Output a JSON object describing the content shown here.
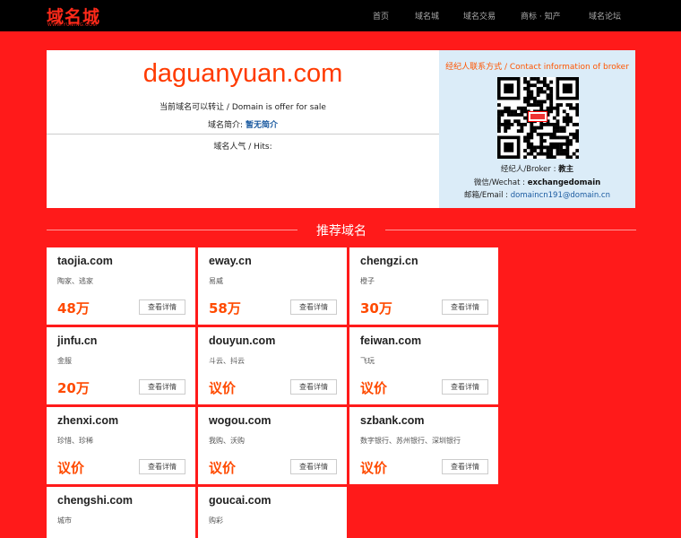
{
  "header": {
    "logo_text": "域名城",
    "logo_sub": "WWW.YUMING.COM",
    "nav": [
      {
        "label": "首页"
      },
      {
        "label": "域名城"
      },
      {
        "label": "域名交易"
      },
      {
        "label": "商标 · 知产"
      },
      {
        "label": "域名论坛"
      }
    ]
  },
  "hero": {
    "domain": "daguanyuan.com",
    "offer_text": "当前域名可以转让 / Domain is offer for sale",
    "intro_label": "域名简介:",
    "intro_value": "暂无简介",
    "hits_label": "域名人气 / Hits:"
  },
  "broker": {
    "title": "经纪人联系方式 / Contact information of broker",
    "broker_label": "经纪人/Broker :",
    "broker_value": "教主",
    "wechat_label": "微信/Wechat :",
    "wechat_value": "exchangedomain",
    "email_label": "邮箱/Email :",
    "email_value": "domaincn191@domain.cn"
  },
  "recommend": {
    "title": "推荐域名",
    "detail_label": "查看详情",
    "cards": [
      {
        "name": "taojia.com",
        "desc": "陶家、逃家",
        "price": "48万"
      },
      {
        "name": "eway.cn",
        "desc": "易威",
        "price": "58万"
      },
      {
        "name": "chengzi.cn",
        "desc": "橙子",
        "price": "30万"
      },
      {
        "name": "jinfu.cn",
        "desc": "金服",
        "price": "20万"
      },
      {
        "name": "douyun.com",
        "desc": "斗云、抖云",
        "price": "议价"
      },
      {
        "name": "feiwan.com",
        "desc": "飞玩",
        "price": "议价"
      },
      {
        "name": "zhenxi.com",
        "desc": "珍惜、珍稀",
        "price": "议价"
      },
      {
        "name": "wogou.com",
        "desc": "我购、沃购",
        "price": "议价"
      },
      {
        "name": "szbank.com",
        "desc": "数字银行、苏州银行、深圳银行",
        "price": "议价"
      },
      {
        "name": "chengshi.com",
        "desc": "城市",
        "price": ""
      },
      {
        "name": "goucai.com",
        "desc": "购彩",
        "price": ""
      }
    ]
  }
}
